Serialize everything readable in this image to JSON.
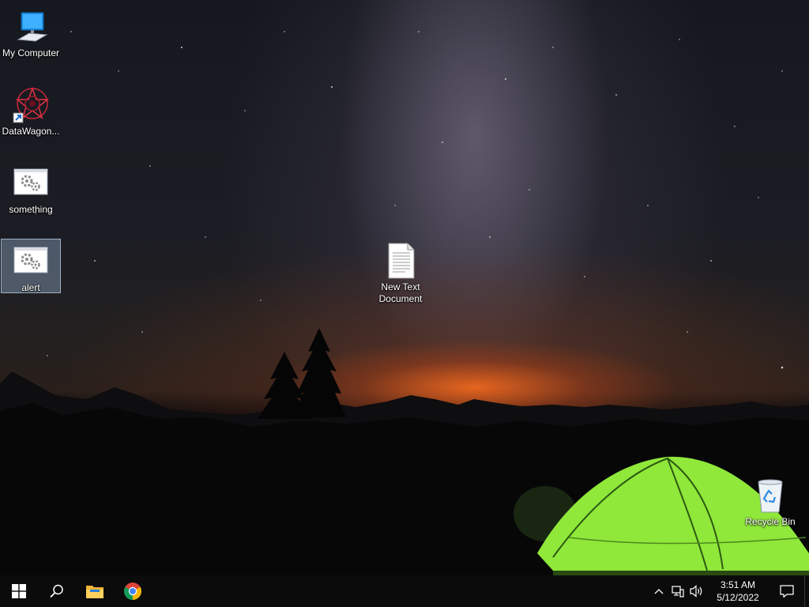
{
  "desktop": {
    "icons": [
      {
        "label": "My Computer",
        "icon": "computer-icon"
      },
      {
        "label": "DataWagon...",
        "icon": "datawagon-shortcut-icon"
      },
      {
        "label": "something",
        "icon": "gear-window-icon"
      },
      {
        "label": "alert",
        "icon": "gear-window-icon",
        "selected": true
      },
      {
        "label": "New Text\nDocument",
        "icon": "text-document-icon"
      },
      {
        "label": "Recycle Bin",
        "icon": "recycle-bin-icon"
      }
    ]
  },
  "taskbar": {
    "start": "windows-start-icon",
    "search": "search-icon",
    "pinned": [
      "file-explorer-icon",
      "chrome-icon"
    ],
    "tray": {
      "icons": [
        "chevron-up-icon",
        "network-icon",
        "volume-icon"
      ],
      "time": "3:51 AM",
      "date": "5/12/2022",
      "notification": "notification-center-icon"
    }
  },
  "colors": {
    "taskbar": "#0b0b0c",
    "selection": "#aac8eb",
    "tent": "#8fe83a",
    "sunset": "#ff6e1e"
  }
}
